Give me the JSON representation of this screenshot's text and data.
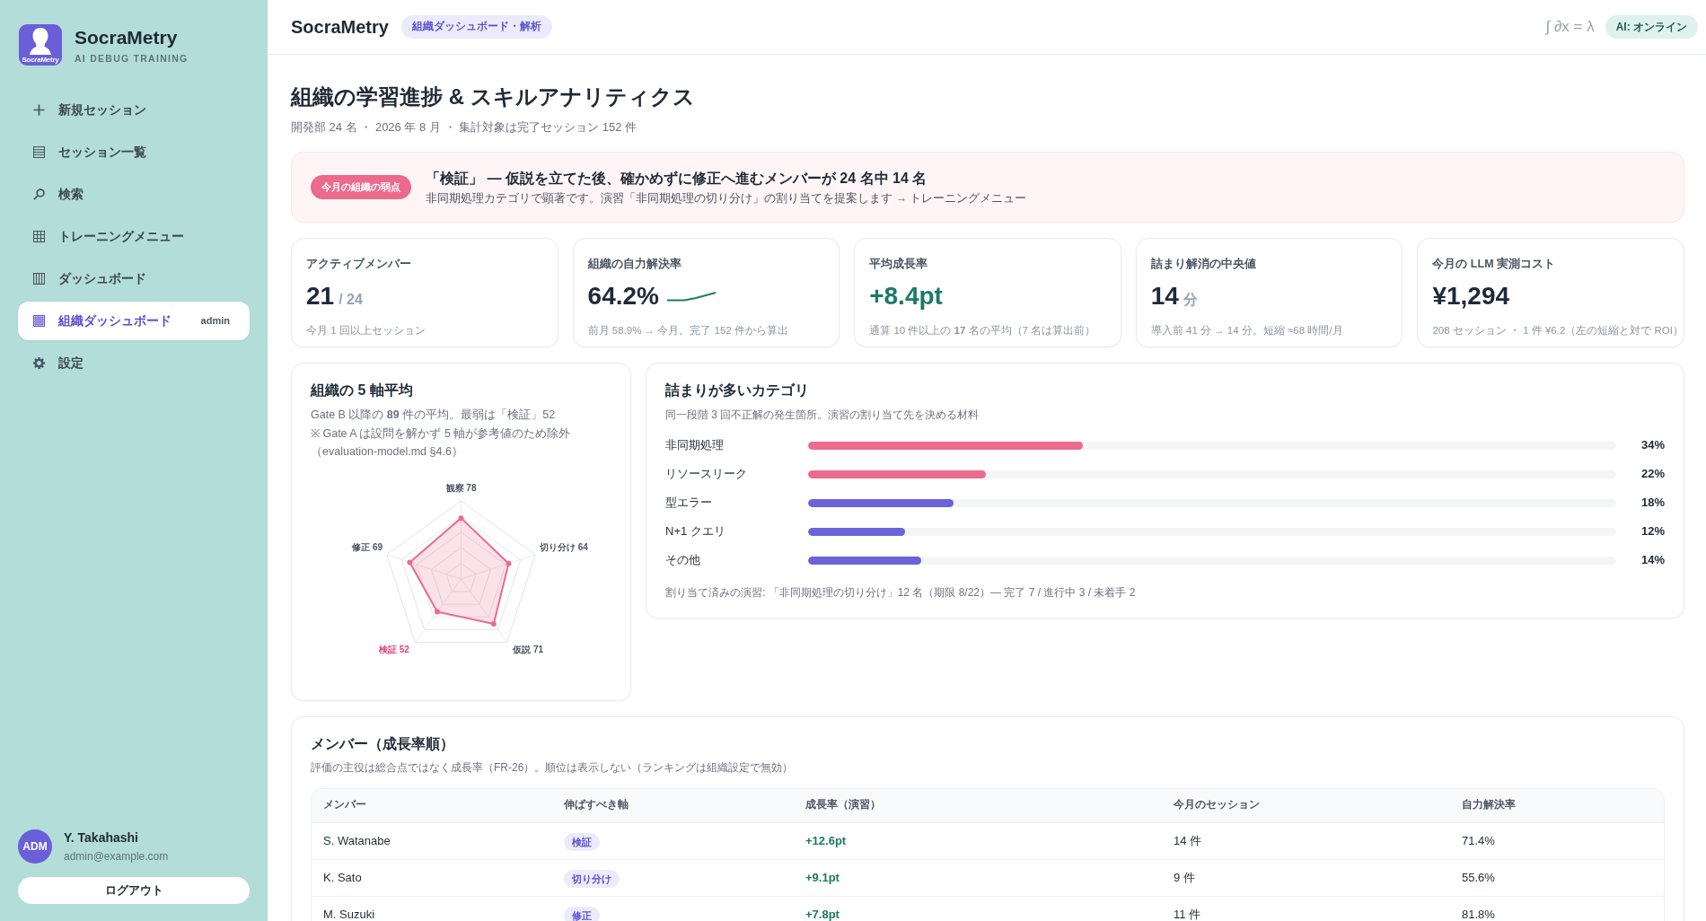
{
  "sidebar": {
    "logo_caption": "SocraMetry",
    "brand": "SocraMetry",
    "tagline": "AI DEBUG TRAINING",
    "items": [
      {
        "label": "新規セッション",
        "selected": false
      },
      {
        "label": "セッション一覧",
        "selected": false
      },
      {
        "label": "検索",
        "selected": false
      },
      {
        "label": "トレーニングメニュー",
        "selected": false
      },
      {
        "label": "ダッシュボード",
        "selected": false
      },
      {
        "label": "組織ダッシュボード",
        "badge": "admin",
        "selected": true
      },
      {
        "label": "設定",
        "selected": false
      }
    ],
    "user": {
      "initials": "ADM",
      "name": "Y. Takahashi",
      "email": "admin@example.com"
    },
    "logout": "ログアウト"
  },
  "header": {
    "title": "SocraMetry",
    "badge": "組織ダッシュボード・解析",
    "formula": "∫ ∂x = λ",
    "ai_status": "AI: オンライン"
  },
  "page": {
    "title": "組織の学習進捗 & スキルアナリティクス",
    "subtitle": "開発部 24 名 ・ 2026 年 8 月 ・ 集計対象は完了セッション 152 件"
  },
  "alert": {
    "tag": "今月の組織の弱点",
    "headline": "「検証」 — 仮説を立てた後、確かめずに修正へ進むメンバーが 24 名中 14 名",
    "detail": "非同期処理カテゴリで顕著です。演習「非同期処理の切り分け」の割り当てを提案します → トレーニングメニュー"
  },
  "kpis": [
    {
      "kind": "plain",
      "label": "アクティブメンバー",
      "value": "21",
      "unit": "/ 24",
      "note": "今月 1 回以上セッション"
    },
    {
      "kind": "trend",
      "label": "組織の自力解決率",
      "value": "64.2%",
      "note": "前月 58.9% → 今月。完了 152 件から算出"
    },
    {
      "kind": "positive",
      "label": "平均成長率",
      "value": "+8.4pt",
      "note": "通算 10 件以上の **17** 名の平均（7 名は算出前）"
    },
    {
      "kind": "plain",
      "label": "詰まり解消の中央値",
      "value": "14",
      "unit": "分",
      "note": "導入前 41 分 → 14 分。短縮 ≈68 時間/月"
    },
    {
      "kind": "plain",
      "label": "今月の LLM 実測コスト",
      "value": "¥1,294",
      "note": "208 セッション ・ 1 件 ¥6.2（左の短縮と対で ROI）"
    }
  ],
  "radar": {
    "title": "組織の 5 軸平均",
    "description": "Gate B 以降の **89** 件の平均。最弱は「検証」52",
    "note": "※ Gate A は設問を解かず 5 軸が参考値のため除外（evaluation-model.md §4.6）",
    "axes": [
      {
        "label": "観察",
        "value": "78",
        "weakest": false
      },
      {
        "label": "切り分け",
        "value": "64",
        "weakest": false
      },
      {
        "label": "仮説",
        "value": "71",
        "weakest": false
      },
      {
        "label": "検証",
        "value": "52",
        "weakest": true
      },
      {
        "label": "修正",
        "value": "69",
        "weakest": false
      }
    ]
  },
  "categories": {
    "title": "詰まりが多いカテゴリ",
    "description": "同一段階 3 回不正解の発生箇所。演習の割り当て先を決める材料",
    "items": [
      {
        "label": "非同期処理",
        "level": 0.34,
        "value": "34%",
        "color": "#ec6a8c"
      },
      {
        "label": "リソースリーク",
        "level": 0.22,
        "value": "22%",
        "color": "#ec6a8c"
      },
      {
        "label": "型エラー",
        "level": 0.18,
        "value": "18%",
        "color": "#6b63d9"
      },
      {
        "label": "N+1 クエリ",
        "level": 0.12,
        "value": "12%",
        "color": "#6b63d9"
      },
      {
        "label": "その他",
        "level": 0.14,
        "value": "14%",
        "color": "#6b63d9"
      }
    ],
    "footer": "割り当て済みの演習: 「非同期処理の切り分け」12 名（期限 8/22）— 完了 7 / 進行中 3 / 未着手 2"
  },
  "members": {
    "title": "メンバー（成長率順）",
    "description": "評価の主役は総合点ではなく成長率（FR-26）。順位は表示しない（ランキングは組織設定で無効）",
    "columns": [
      "メンバー",
      "伸ばすべき軸",
      "成長率（演習）",
      "今月のセッション",
      "自力解決率"
    ],
    "rows": [
      {
        "name": "S. Watanabe",
        "axis": "検証",
        "growth": "+12.6pt",
        "sessions": "14 件",
        "solve_rate": "71.4%"
      },
      {
        "name": "K. Sato",
        "axis": "切り分け",
        "growth": "+9.1pt",
        "sessions": "9 件",
        "solve_rate": "55.6%"
      },
      {
        "name": "M. Suzuki",
        "axis": "修正",
        "growth": "+7.8pt",
        "sessions": "11 件",
        "solve_rate": "81.8%"
      }
    ]
  }
}
